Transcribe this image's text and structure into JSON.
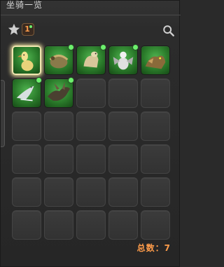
{
  "window": {
    "title": "坐骑一览"
  },
  "toolbar": {
    "favorite_icon": "star-icon",
    "badge_count": "1",
    "search_icon": "search-icon"
  },
  "mounts": [
    {
      "name": "chocobo",
      "filled": true,
      "selected": true,
      "new": false
    },
    {
      "name": "armored-beetle",
      "filled": true,
      "selected": false,
      "new": true
    },
    {
      "name": "camel",
      "filled": true,
      "selected": false,
      "new": true
    },
    {
      "name": "griffin",
      "filled": true,
      "selected": false,
      "new": true
    },
    {
      "name": "wolf-beast",
      "filled": true,
      "selected": false,
      "new": false
    },
    {
      "name": "bird-white",
      "filled": true,
      "selected": false,
      "new": true
    },
    {
      "name": "dragon-dark",
      "filled": true,
      "selected": false,
      "new": true
    }
  ],
  "grid": {
    "rows": 6,
    "cols": 5
  },
  "footer": {
    "total_label": "总数：7"
  },
  "colors": {
    "accent": "#ff9c4a",
    "new_dot": "#6df06d",
    "slot_green": "#2a7a2a"
  }
}
